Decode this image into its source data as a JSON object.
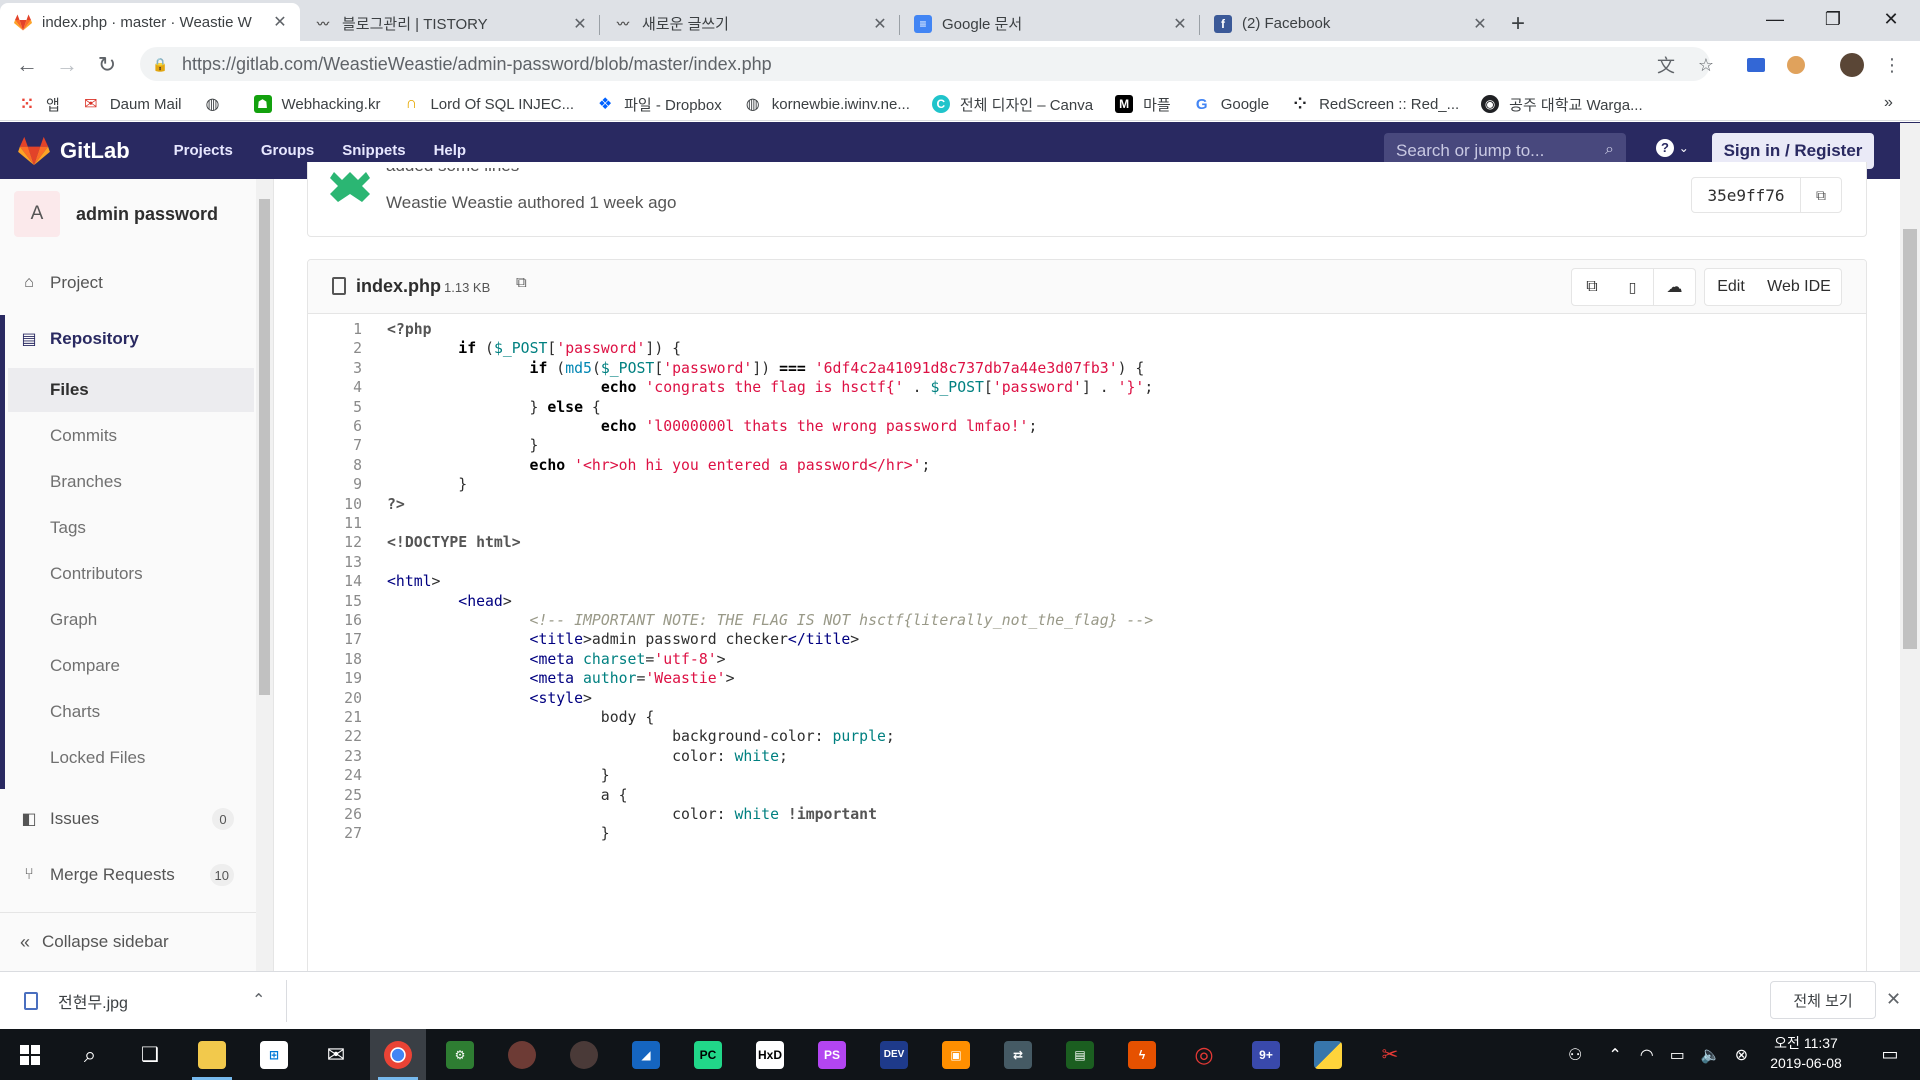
{
  "browser": {
    "tabs": [
      {
        "title": "index.php · master · Weastie W",
        "icon": "gitlab-icon",
        "active": true
      },
      {
        "title": "블로그관리 | TISTORY",
        "icon": "tistory-icon"
      },
      {
        "title": "새로운 글쓰기",
        "icon": "tistory-icon"
      },
      {
        "title": "Google 문서",
        "icon": "google-docs-icon"
      },
      {
        "title": "(2) Facebook",
        "icon": "facebook-icon"
      }
    ],
    "url": "https://gitlab.com/WeastieWeastie/admin-password/blob/master/index.php",
    "bookmarks": [
      {
        "label": "앱",
        "icon": "apps-grid-icon"
      },
      {
        "label": "Daum Mail",
        "icon": "mail-icon"
      },
      {
        "label": "",
        "icon": "globe-icon"
      },
      {
        "label": "Webhacking.kr",
        "icon": "webhacking-icon"
      },
      {
        "label": "Lord Of SQL INJEC...",
        "icon": "los-icon"
      },
      {
        "label": "파일 - Dropbox",
        "icon": "dropbox-icon"
      },
      {
        "label": "kornewbie.iwinv.ne...",
        "icon": "globe-icon"
      },
      {
        "label": "전체 디자인 – Canva",
        "icon": "canva-icon"
      },
      {
        "label": "마플",
        "icon": "marpple-icon"
      },
      {
        "label": "Google",
        "icon": "google-icon"
      },
      {
        "label": "RedScreen :: Red_...",
        "icon": "redscreen-icon"
      },
      {
        "label": "공주 대학교 Warga...",
        "icon": "wargame-icon"
      }
    ],
    "bookmarks_more": "»"
  },
  "gitlab": {
    "brand": "GitLab",
    "nav": [
      "Projects",
      "Groups",
      "Snippets",
      "Help"
    ],
    "search_placeholder": "Search or jump to...",
    "help_icon": "?",
    "signin": "Sign in / Register"
  },
  "sidebar": {
    "avatar_letter": "A",
    "project_name": "admin password",
    "items": [
      {
        "label": "Project",
        "icon": "home-icon"
      },
      {
        "label": "Repository",
        "icon": "document-icon"
      }
    ],
    "sub_items": [
      "Files",
      "Commits",
      "Branches",
      "Tags",
      "Contributors",
      "Graph",
      "Compare",
      "Charts",
      "Locked Files"
    ],
    "issues": {
      "label": "Issues",
      "count": "0"
    },
    "merge_requests": {
      "label": "Merge Requests",
      "count": "10"
    },
    "collapse": "Collapse sidebar"
  },
  "commit": {
    "message": "added some lines",
    "author_line": "Weastie Weastie authored 1 week ago",
    "sha": "35e9ff76"
  },
  "file": {
    "name": "index.php",
    "size": "1.13 KB",
    "buttons": [
      "Edit",
      "Web IDE"
    ],
    "icon_buttons": [
      "copy-source-icon",
      "raw-file-icon",
      "download-icon"
    ]
  },
  "code_lines": [
    "<?php",
    "        if ($_POST['password']) {",
    "                if (md5($_POST['password']) === '6df4c2a41091d8c737db7a44e3d07fb3') {",
    "                        echo 'congrats the flag is hsctf{' . $_POST['password'] . '}';",
    "                } else {",
    "                        echo 'l0000000l thats the wrong password lmfao!';",
    "                }",
    "                echo '<hr>oh hi you entered a password</hr>';",
    "        }",
    "?>",
    "",
    "<!DOCTYPE html>",
    "",
    "<html>",
    "        <head>",
    "                <!-- IMPORTANT NOTE: THE FLAG IS NOT hsctf{literally_not_the_flag} -->",
    "                <title>admin password checker</title>",
    "                <meta charset='utf-8'>",
    "                <meta author='Weastie'>",
    "                <style>",
    "                        body {",
    "                                background-color: purple;",
    "                                color: white;",
    "                        }",
    "                        a {",
    "                                color: white !important",
    "                        }"
  ],
  "downloads": {
    "file": "전현무.jpg",
    "show_all": "전체 보기"
  },
  "taskbar": {
    "time": "오전 11:37",
    "date": "2019-06-08"
  }
}
